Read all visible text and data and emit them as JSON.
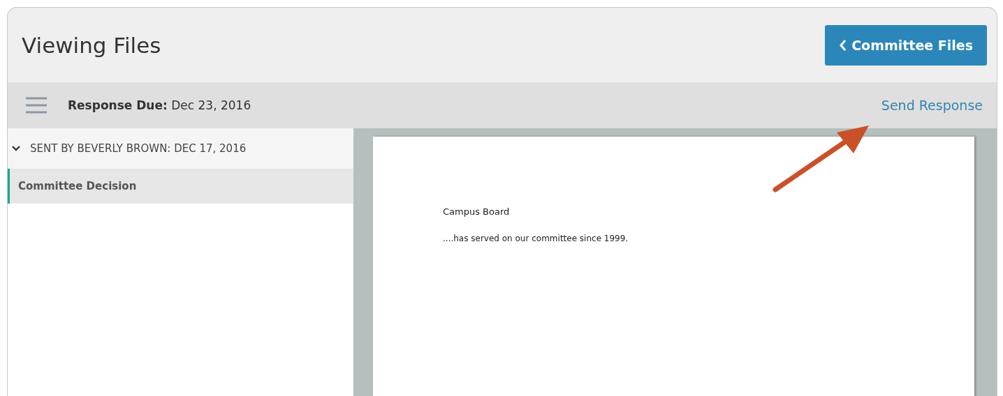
{
  "header": {
    "title": "Viewing Files",
    "back_button": "Committee Files"
  },
  "toolbar": {
    "due_label": "Response Due:",
    "due_date": "Dec 23, 2016",
    "send_link": "Send Response"
  },
  "sidebar": {
    "groups": [
      {
        "label": "SENT BY BEVERLY BROWN: DEC 17, 2016",
        "expanded": true,
        "items": [
          {
            "label": "Committee Decision",
            "selected": true
          }
        ]
      }
    ]
  },
  "document": {
    "heading": "Campus Board",
    "body": "....has served on our committee since 1999."
  }
}
